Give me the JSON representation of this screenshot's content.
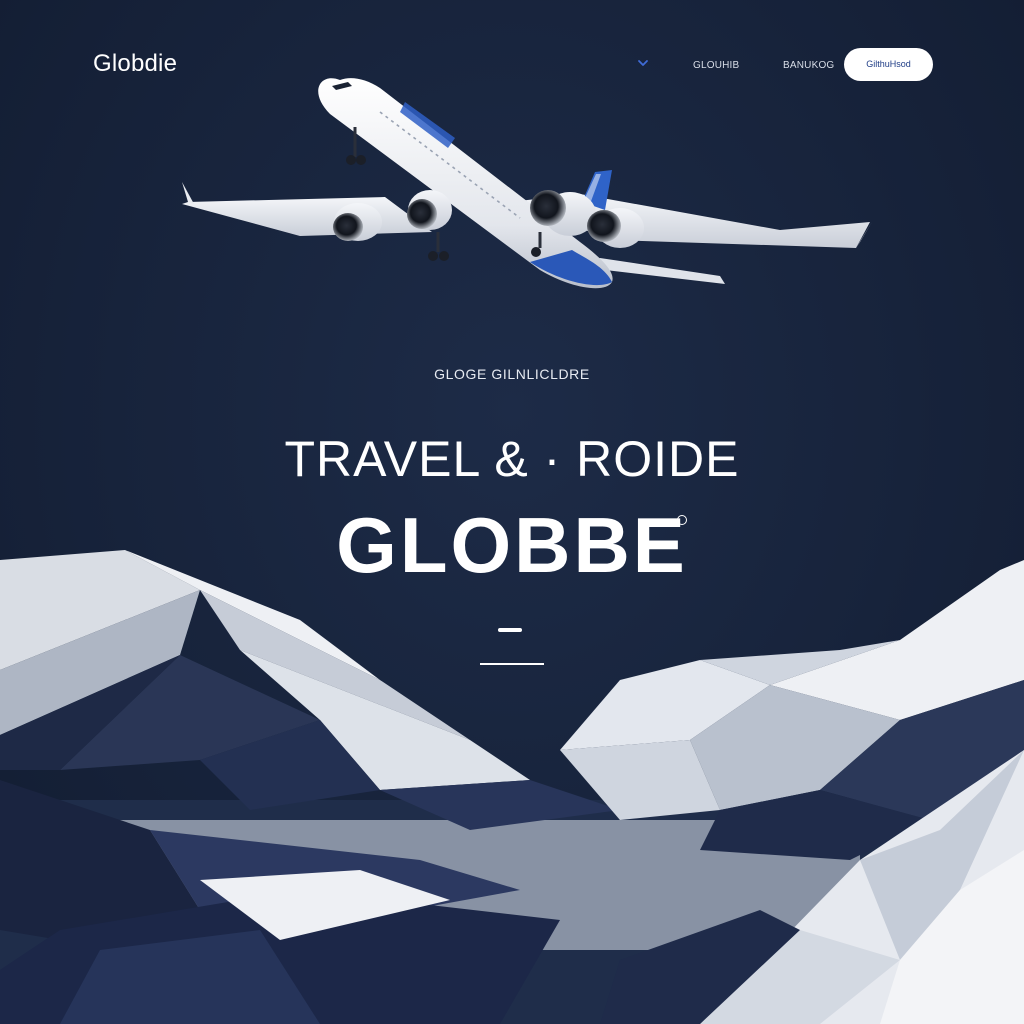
{
  "nav": {
    "logo": "Globdie",
    "link_1": "GLOUHIB",
    "link_2": "BANUKOG",
    "cta_label": "GilthuHsod"
  },
  "hero": {
    "eyebrow": "GLOGE GILNLICLDRE",
    "headline": "TRAVEL & · ROIDE",
    "brand": "GLOBBE"
  },
  "colors": {
    "background": "#17233b",
    "accent": "#3f6bd6",
    "cta_text": "#1f3d86",
    "text": "#ffffff"
  },
  "icons": {
    "nav_chevron": "chevron-down-icon"
  }
}
